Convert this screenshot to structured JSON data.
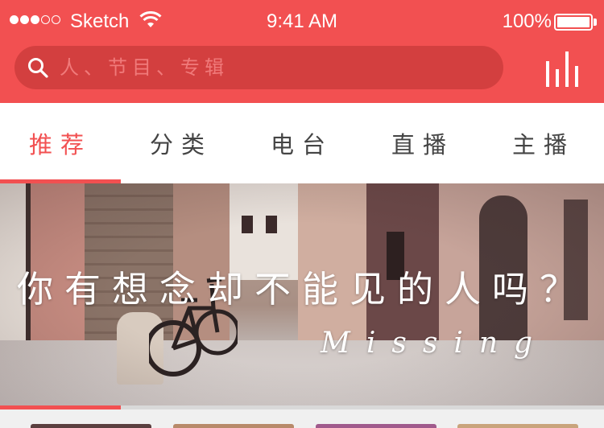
{
  "status_bar": {
    "carrier": "Sketch",
    "time": "9:41 AM",
    "battery_pct": "100%",
    "signal_bars_filled": 3,
    "signal_bars_total": 5
  },
  "search": {
    "placeholder": "人、节目、专辑"
  },
  "header": {
    "rank_icon": "bar-chart-icon",
    "accent_color": "#f25051"
  },
  "tabs": [
    {
      "label": "推荐",
      "active": true
    },
    {
      "label": "分类",
      "active": false
    },
    {
      "label": "电台",
      "active": false
    },
    {
      "label": "直播",
      "active": false
    },
    {
      "label": "主播",
      "active": false
    }
  ],
  "banner": {
    "title": "你有想念却不能见的人吗？",
    "script": "Missing"
  },
  "pager": {
    "active_index": 0,
    "count": 5
  }
}
